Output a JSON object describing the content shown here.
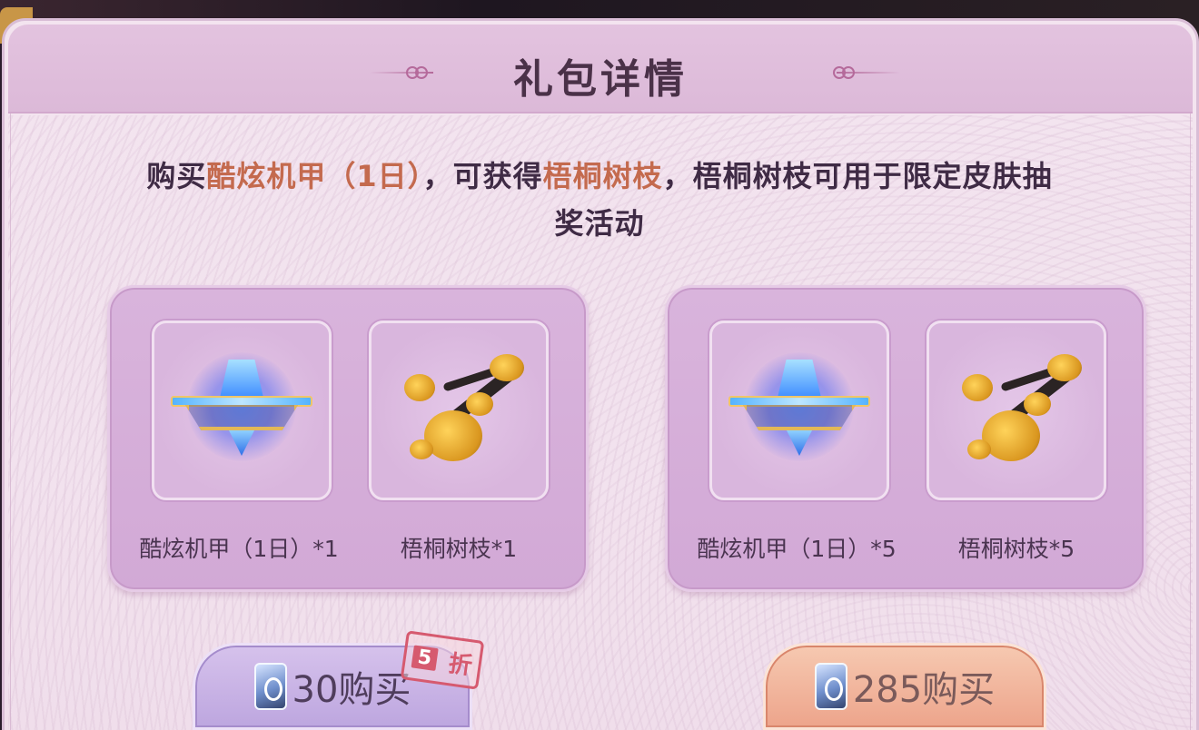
{
  "dialog": {
    "title": "礼包详情"
  },
  "description": {
    "prefix": "购买",
    "item_highlight": "酷炫机甲（1日）",
    "middle": "，可获得",
    "reward_highlight": "梧桐树枝",
    "suffix": "，梧桐树枝可用于限定皮肤抽奖活动"
  },
  "packs": [
    {
      "items": [
        {
          "icon": "mecha-icon",
          "label": "酷炫机甲（1日）*1"
        },
        {
          "icon": "wutong-branch-icon",
          "label": "梧桐树枝*1"
        }
      ],
      "button": {
        "icon": "coupon-icon",
        "label": "30购买"
      },
      "discount": {
        "number": "5",
        "text": "折"
      }
    },
    {
      "items": [
        {
          "icon": "mecha-icon",
          "label": "酷炫机甲（1日）*5"
        },
        {
          "icon": "wutong-branch-icon",
          "label": "梧桐树枝*5"
        }
      ],
      "button": {
        "icon": "coupon-icon",
        "label": "285购买"
      }
    }
  ],
  "colors": {
    "highlight": "#c46a4e",
    "panel_bg": "#f2e2ee",
    "header_bg": "#dcb9d8",
    "card_bg": "#d2a9d6",
    "button_purple": "#bda6df",
    "button_orange": "#eda48b",
    "text_dark": "#3f2b45"
  }
}
